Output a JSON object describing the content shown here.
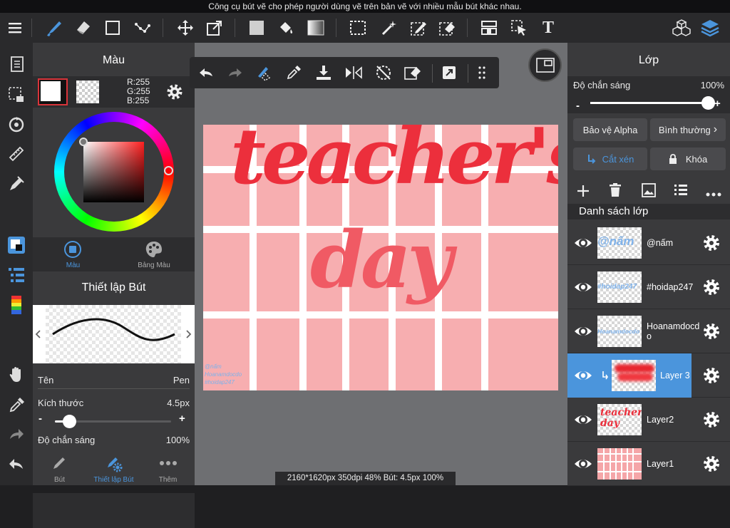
{
  "tip_text": "Công cụ bút vẽ cho phép người dùng vẽ trên bản vẽ với nhiều mẫu bút khác nhau.",
  "toolbar": {
    "icons": [
      "menu-icon",
      "brush-icon",
      "eraser-icon",
      "rectangle-icon",
      "select-dots-icon",
      "move-icon",
      "transform-icon",
      "fill-color-icon",
      "bucket-icon",
      "gradient-icon",
      "select-rect-icon",
      "magic-wand-icon",
      "select-pen-icon",
      "select-eraser-icon",
      "layout-icon",
      "select-pointer-icon"
    ],
    "text_tool_glyph": "T"
  },
  "color_panel": {
    "title": "Màu",
    "rgb_r": "R:255",
    "rgb_g": "G:255",
    "rgb_b": "B:255",
    "tab_color": "Màu",
    "tab_palette": "Bảng Màu"
  },
  "brush_panel": {
    "title": "Thiết lập Bút",
    "name_label": "Tên",
    "name_value": "Pen",
    "size_label": "Kích thước",
    "size_value": "4.5px",
    "size_fraction": 0.12,
    "opacity_label": "Độ chắn sáng",
    "opacity_value": "100%",
    "minus": "-",
    "plus": "+"
  },
  "bottom_tabs": {
    "pen": "Bút",
    "pen_settings": "Thiết lập Bút",
    "more": "Thêm"
  },
  "canvas_art": {
    "word1": "teacher's",
    "word2": "day",
    "watermark_line1": "@nấm",
    "watermark_line2": "Hoanamdocdo",
    "watermark_line3": "#hoidap247"
  },
  "layer_panel": {
    "title": "Lớp",
    "opacity_label": "Độ chắn sáng",
    "opacity_value": "100%",
    "opacity_fraction": 1.0,
    "alpha_protect": "Bảo vệ Alpha",
    "blend_mode": "Bình thường",
    "clipping": "Cắt xén",
    "lock": "Khóa",
    "list_title": "Danh sách lớp",
    "layers": [
      {
        "name": "@nấm",
        "thumb_text": "@nấm",
        "selected": false
      },
      {
        "name": "#hoidap247",
        "thumb_text": "#hoidap247",
        "selected": false
      },
      {
        "name": "Hoanamdocdo",
        "thumb_text": "Hoanamdocdo",
        "selected": false
      },
      {
        "name": "Layer 3",
        "thumb_text": "",
        "selected": true
      },
      {
        "name": "Layer2",
        "thumb_text": "teacher's day",
        "selected": false
      },
      {
        "name": "Layer1",
        "thumb_text": "",
        "selected": false
      }
    ]
  },
  "status_text": "2160*1620px 350dpi 48% Bút: 4.5px 100%",
  "colors": {
    "accent": "#4b95dc",
    "canvas_pink": "#f7aeb0",
    "lettering_red": "#ec2f3c",
    "selection_red": "#d9343a"
  }
}
